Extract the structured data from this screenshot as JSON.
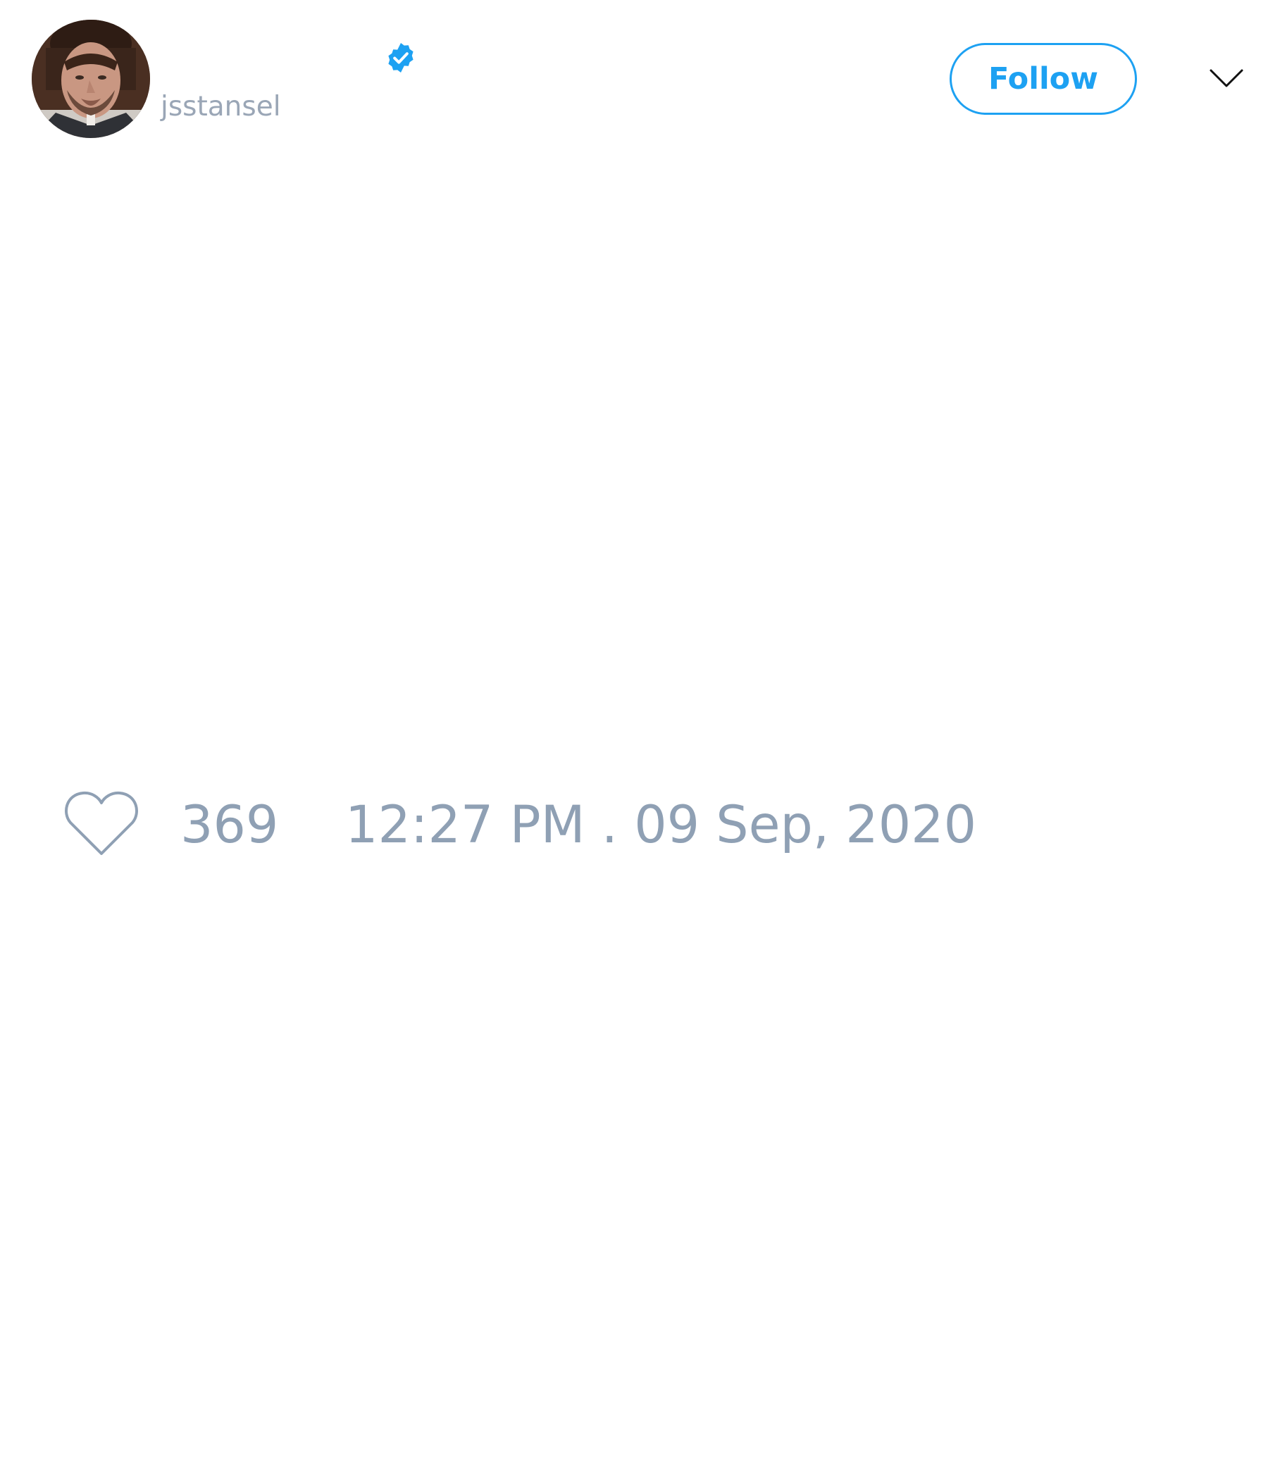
{
  "tweet": {
    "author": {
      "handle": "jsstansel",
      "verified": true,
      "avatar_icon": "user-avatar-photo"
    },
    "follow_label": "Follow",
    "menu_icon": "chevron-down-icon",
    "likes": {
      "icon": "heart-icon",
      "count": "369"
    },
    "timestamp": "12:27 PM . 09 Sep, 2020"
  },
  "colors": {
    "accent": "#1da1f2",
    "muted_text": "#8fa0b4",
    "background": "#ffffff"
  }
}
